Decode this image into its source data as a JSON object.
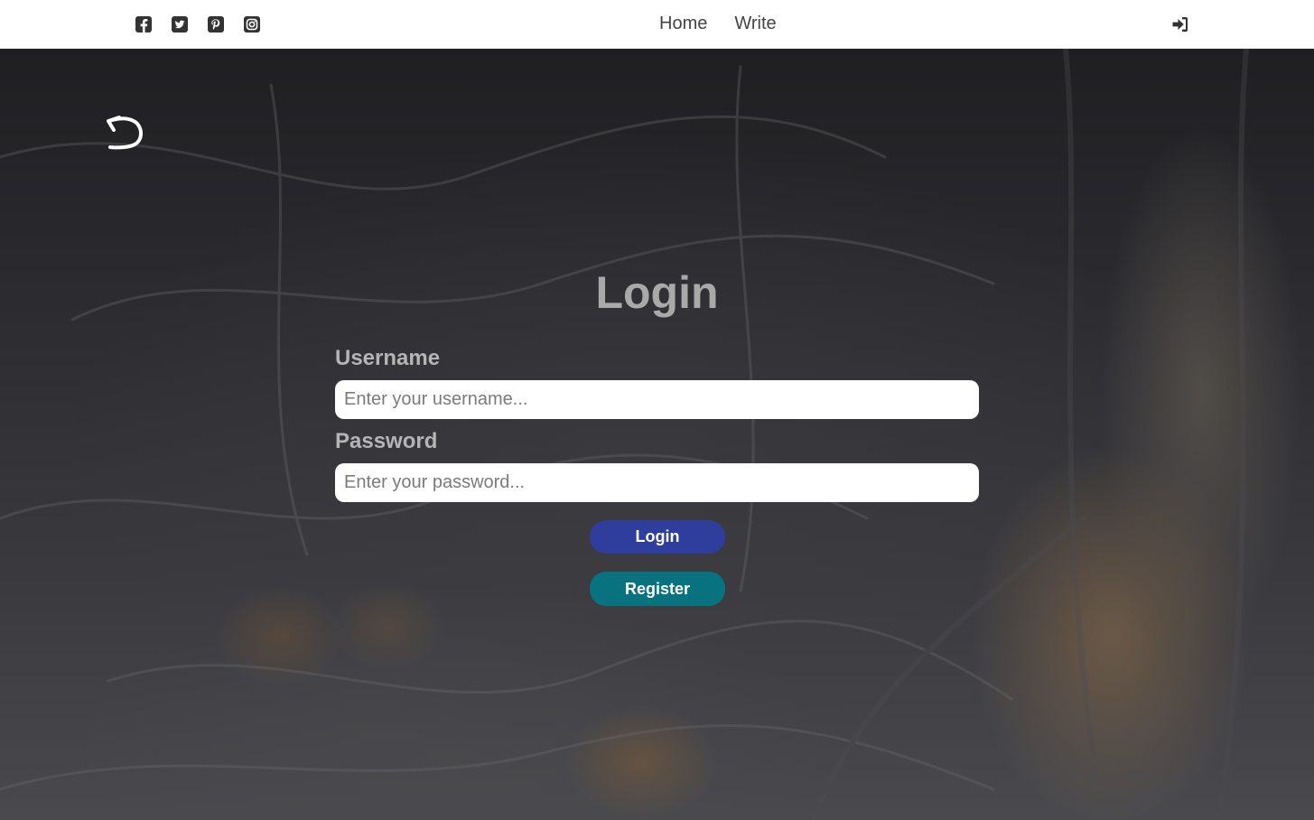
{
  "header": {
    "social": [
      {
        "icon": "facebook-square-icon"
      },
      {
        "icon": "twitter-square-icon"
      },
      {
        "icon": "pinterest-square-icon"
      },
      {
        "icon": "instagram-square-icon"
      }
    ],
    "nav": [
      {
        "label": "Home"
      },
      {
        "label": "Write"
      }
    ],
    "login_icon": "sign-in-icon"
  },
  "main": {
    "back_icon": "undo-arrow-icon",
    "title": "Login",
    "username": {
      "label": "Username",
      "placeholder": "Enter your username...",
      "value": ""
    },
    "password": {
      "label": "Password",
      "placeholder": "Enter your password...",
      "value": ""
    },
    "login_button": "Login",
    "register_button": "Register"
  },
  "colors": {
    "login_button": "#2f3d9c",
    "register_button": "#08727e",
    "title": "#a9a9a9",
    "label": "#b5b5b5"
  }
}
